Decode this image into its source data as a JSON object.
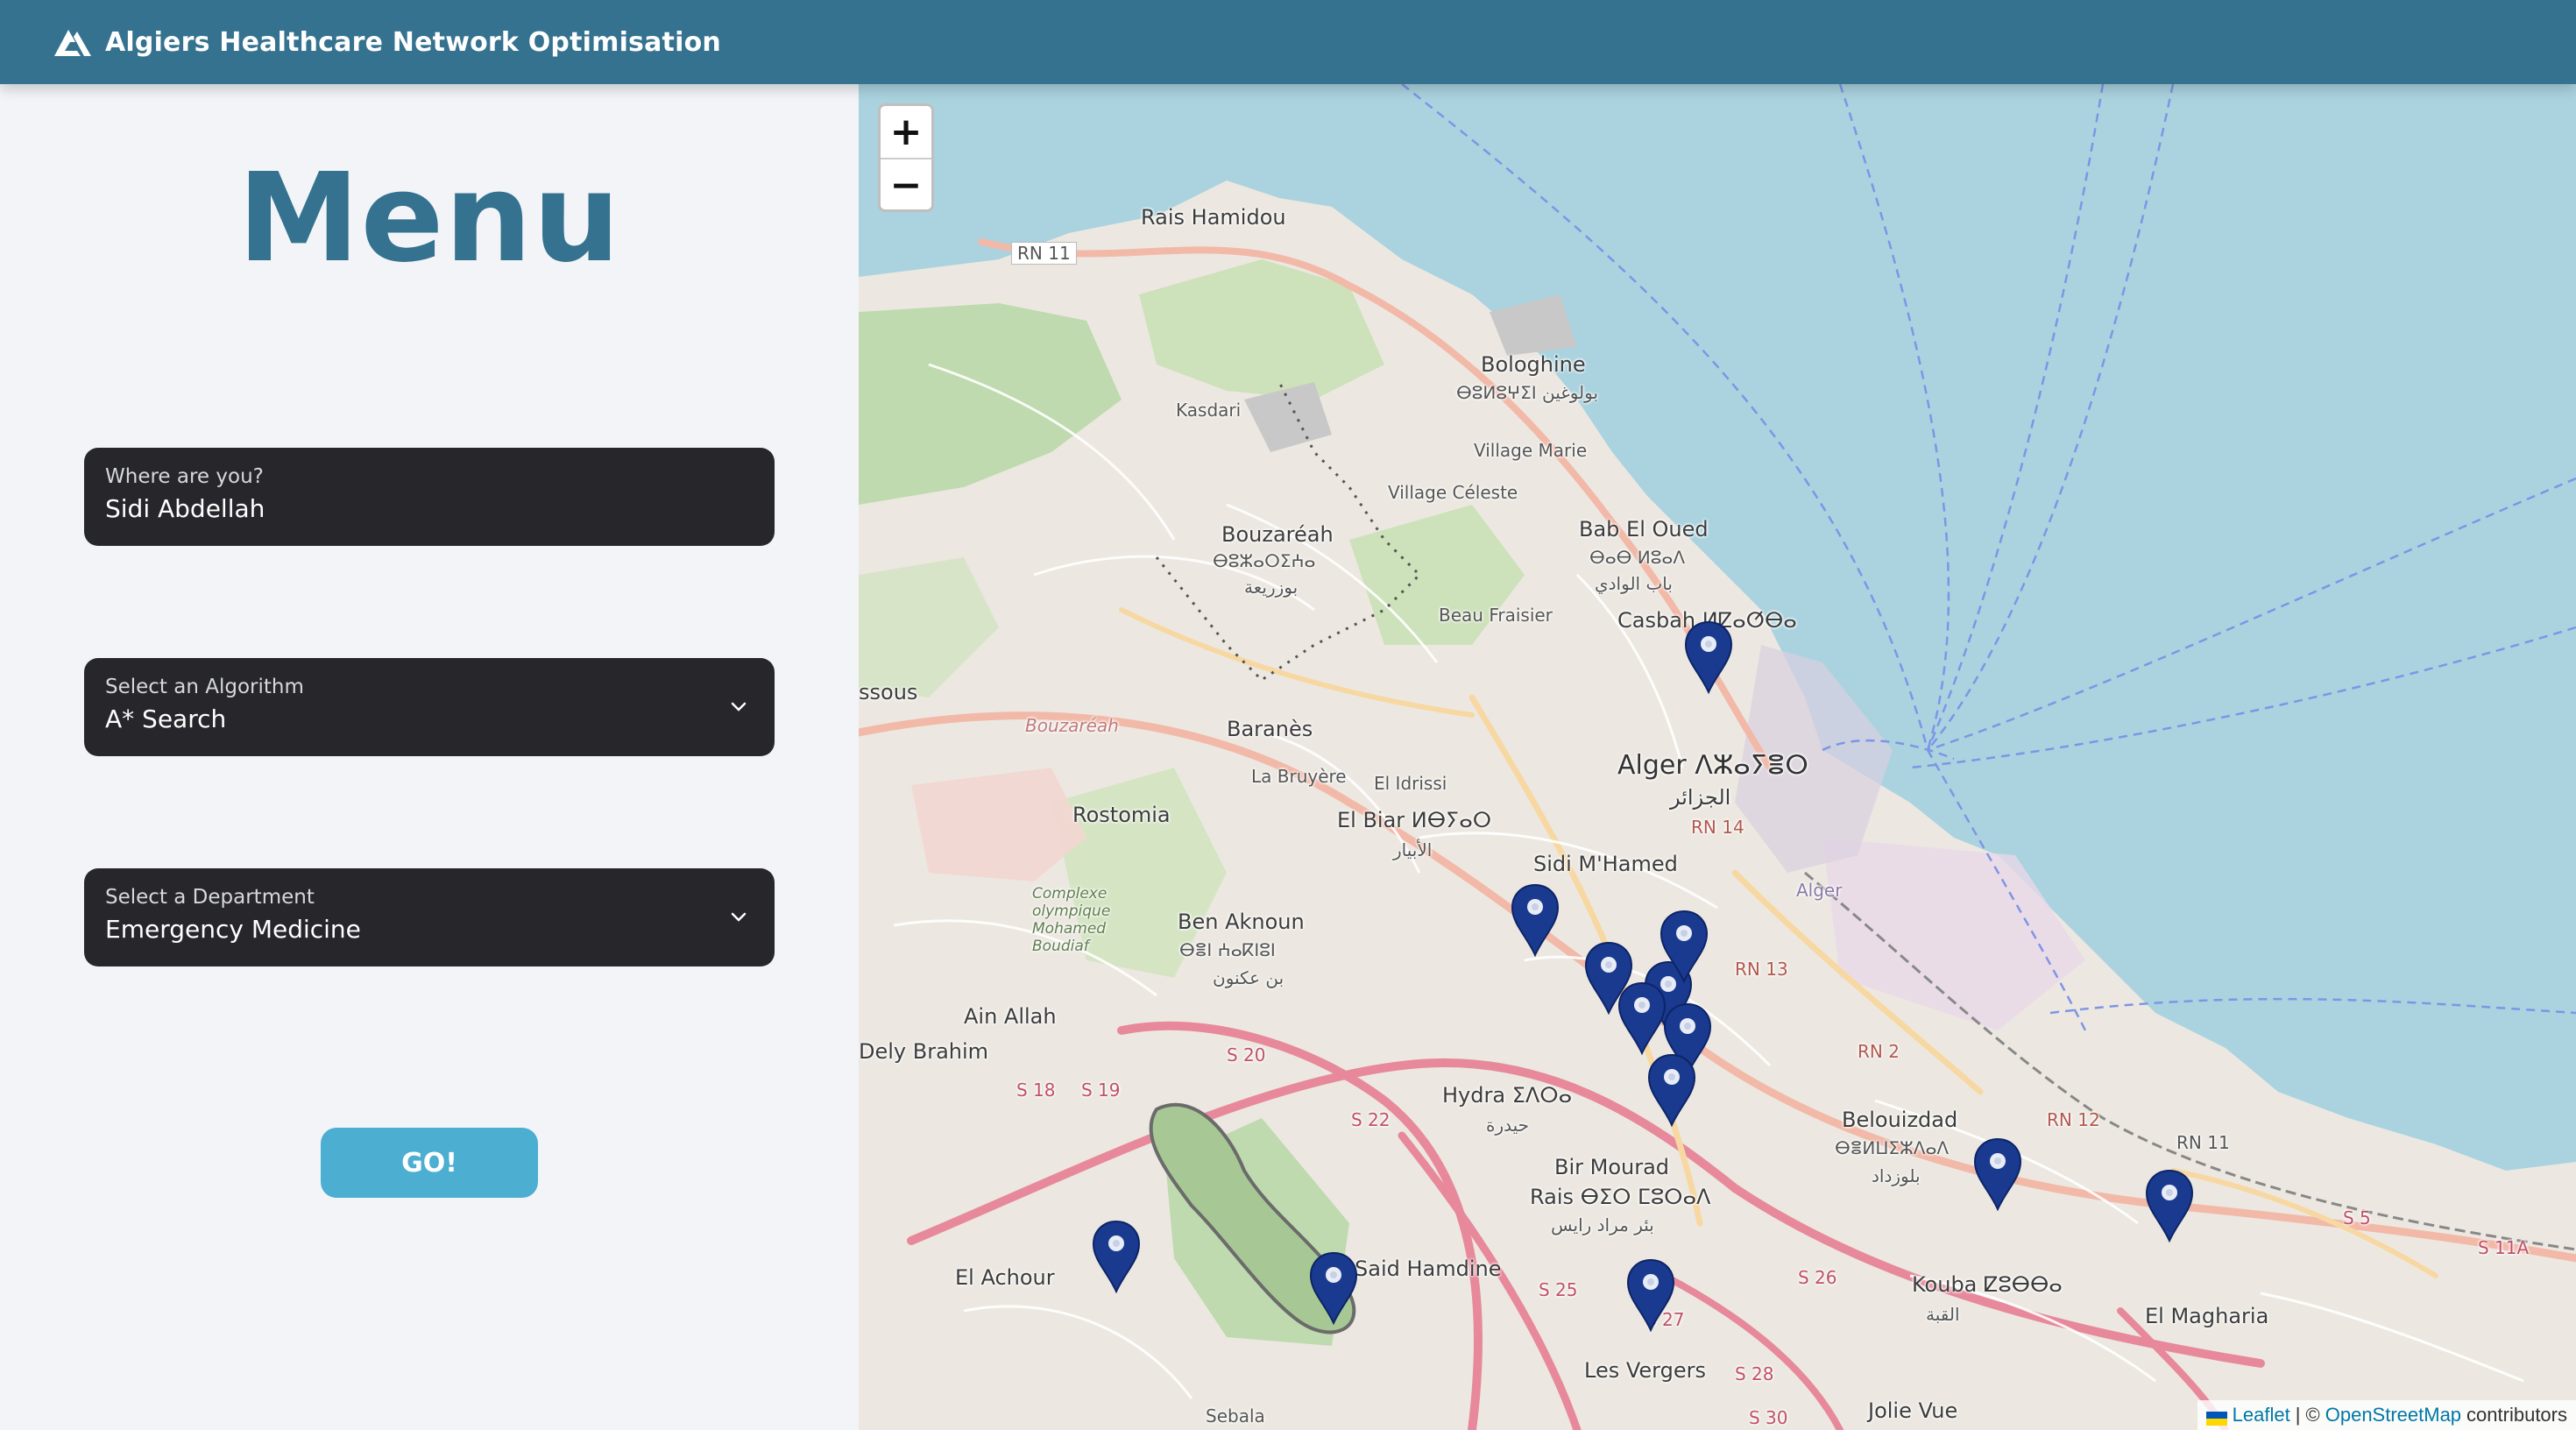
{
  "header": {
    "title": "Algiers Healthcare Network Optimisation",
    "logo_icon": "mountain-logo-icon"
  },
  "sidebar": {
    "title": "Menu",
    "location": {
      "label": "Where are you?",
      "value": "Sidi Abdellah"
    },
    "algorithm": {
      "label": "Select an Algorithm",
      "value": "A* Search"
    },
    "department": {
      "label": "Select a Department",
      "value": "Emergency Medicine"
    },
    "go_label": "GO!"
  },
  "map": {
    "zoom_in": "+",
    "zoom_out": "−",
    "attribution": {
      "leaflet": "Leaflet",
      "sep": "| ©",
      "osm": "OpenStreetMap",
      "suffix": "contributors"
    },
    "place_labels": {
      "rais_hamidou": "Rais Hamidou",
      "bologhine": "Bologhine",
      "bologhine_ber": "ⴱⵓⵍⵓⵖⵉⵏ بولوغين",
      "village_marie": "Village Marie",
      "village_celeste": "Village Céleste",
      "kasdari": "Kasdari",
      "bouzareah": "Bouzaréah",
      "bouzareah_ber": "ⴱⵓⵣⴰⵔⵉⵄⴰ",
      "bouzareah_ar": "بوزريعة",
      "bab_el_oued": "Bab El Oued",
      "bab_el_oued_ber": "ⴱⴰⴱ ⵍⵓⴰⴷ",
      "bab_el_oued_ar": "باب الوادي",
      "beau_fraisier": "Beau Fraisier",
      "casbah": "Casbah ⵍⵇⴰⵚⴱⴰ",
      "baranes": "Baranès",
      "la_bruyere": "La Bruyère",
      "el_idrissi": "El Idrissi",
      "el_biar": "El Biar ⵍⴱⵢⴰⵔ",
      "el_biar_ar": "الأبيار",
      "alger": "Alger ⴷⵣⴰⵢⴻⵔ",
      "alger_ar": "الجزائر",
      "rostomia": "Rostomia",
      "sidi_mhamed": "Sidi M'Hamed",
      "ben_aknoun": "Ben Aknoun",
      "ben_aknoun_ber": "ⴱⴻⵏ ⵄⴰⴽⵏⵓⵏ",
      "ben_aknoun_ar": "بن عكنون",
      "ain_allah": "Ain Allah",
      "dely_brahim": "Dely Brahim",
      "hydra": "Hydra ⵉⴷⵔⴰ",
      "hydra_ar": "حيدرة",
      "belouizdad": "Belouizdad",
      "belouizdad_ber": "ⴱⴻⵍⵡⵉⵣⴷⴰⴷ",
      "belouizdad_ar": "بلوزداد",
      "bir_mourad_rais": "Bir Mourad",
      "bir_mourad_rais_2": "Rais ⴱⵉⵔ ⵎⵓⵔⴰⴷ",
      "bir_mourad_rais_ar": "بئر مراد رايس",
      "said_hamdine": "Said Hamdine",
      "el_achour": "El Achour",
      "kouba": "Kouba ⵇⵓⴱⴱⴰ",
      "kouba_ar": "القبة",
      "el_magharia": "El Magharia",
      "les_vergers": "Les Vergers",
      "jolie_vue": "Jolie Vue",
      "sebala": "Sebala",
      "ssous": "ssous",
      "alger_port": "Alger",
      "bouzareah_area": "Bouzaréah",
      "complexe": "Complexe olympique Mohamed Boudiaf"
    },
    "road_labels": [
      "RN 11",
      "RN 14",
      "RN 13",
      "RN 2",
      "RN 12",
      "RN 11",
      "S 20",
      "S 22",
      "S 18",
      "S 19",
      "S 25",
      "S 27",
      "S 28",
      "S 30",
      "S 26",
      "S 22",
      "S 5",
      "S 11A"
    ],
    "marker_color": "#1a3a8f"
  }
}
